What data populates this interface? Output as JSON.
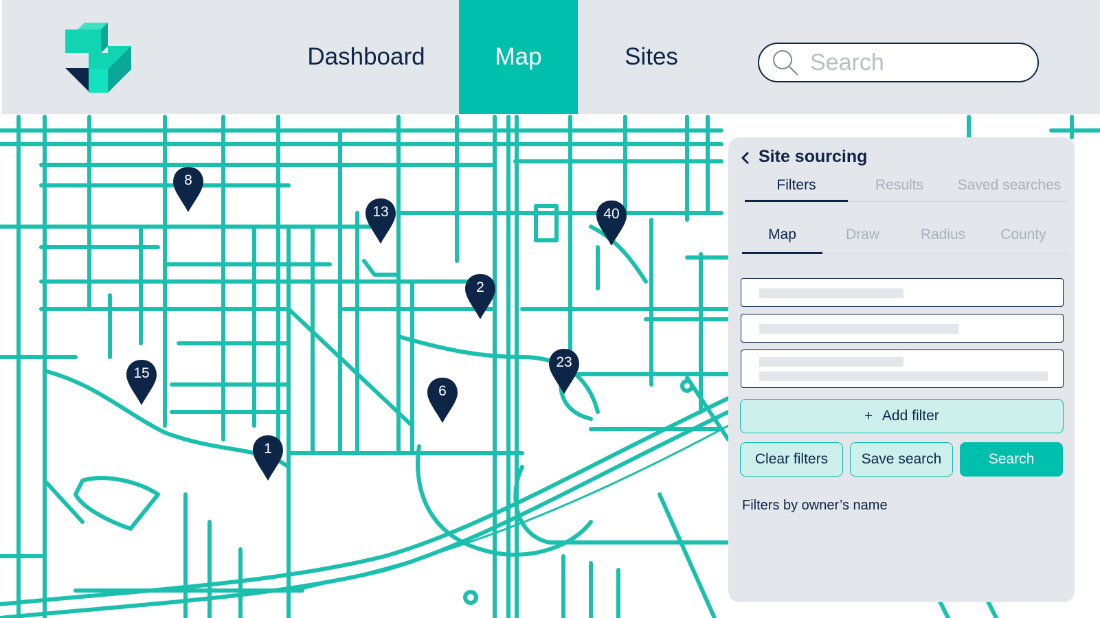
{
  "nav": {
    "items": [
      {
        "label": "Dashboard",
        "active": false
      },
      {
        "label": "Map",
        "active": true
      },
      {
        "label": "Sites",
        "active": false
      }
    ],
    "search_placeholder": "Search"
  },
  "colors": {
    "accent": "#00bfac",
    "navy": "#0d2547",
    "header_bg": "#e3e6ea",
    "accent_light": "#cdf0ed"
  },
  "map": {
    "markers": [
      "8",
      "13",
      "40",
      "2",
      "15",
      "23",
      "6",
      "1"
    ]
  },
  "panel": {
    "title": "Site sourcing",
    "tabs": [
      "Filters",
      "Results",
      "Saved searches"
    ],
    "active_tab": "Filters",
    "sub_tabs": [
      "Map",
      "Draw",
      "Radius",
      "County"
    ],
    "active_sub_tab": "Map",
    "add_filter_label": "Add filter",
    "clear_filters_label": "Clear filters",
    "save_search_label": "Save search",
    "search_label": "Search",
    "hint": "Filters by owner’s name"
  }
}
